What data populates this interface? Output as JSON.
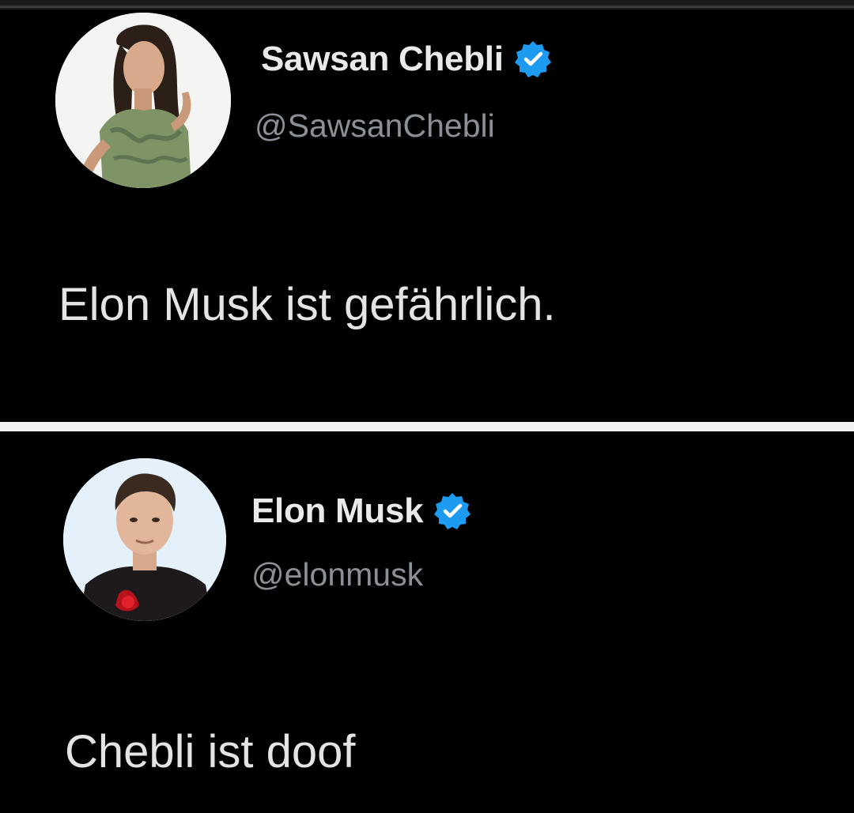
{
  "tweets": [
    {
      "display_name": "Sawsan Chebli",
      "handle": "@SawsanChebli",
      "verified": true,
      "text": "Elon Musk ist gefährlich.",
      "avatar_icon": "avatar-photo-woman"
    },
    {
      "display_name": "Elon Musk",
      "handle": "@elonmusk",
      "verified": true,
      "text": "Chebli ist doof",
      "avatar_icon": "avatar-photo-man"
    }
  ],
  "colors": {
    "background": "#000000",
    "divider": "#f2f2f2",
    "text": "#e4e4e4",
    "handle": "#8b9096",
    "verified_badge": "#1d9bf0"
  },
  "icons": {
    "verified": "verified-badge-icon"
  }
}
